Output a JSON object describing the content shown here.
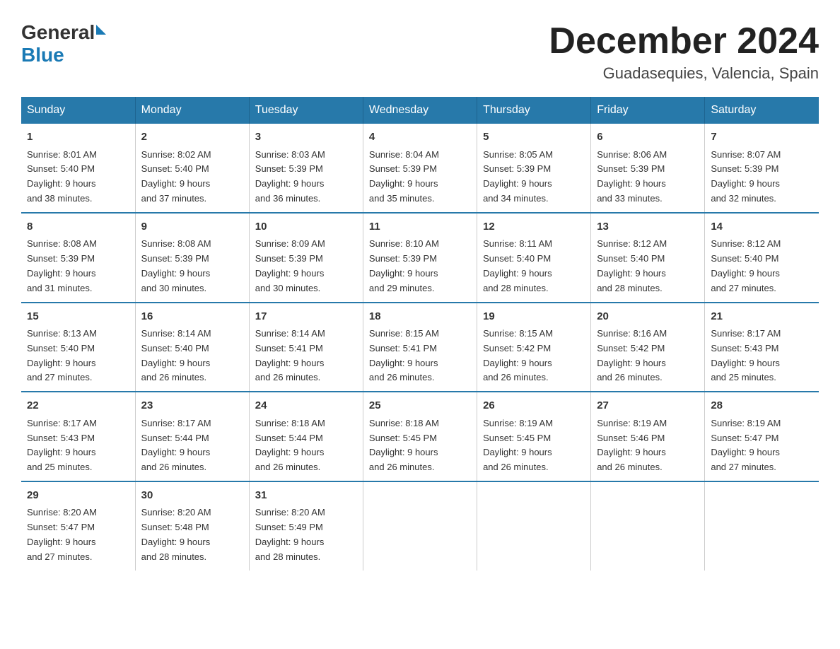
{
  "logo": {
    "general": "General",
    "triangle": "▶",
    "blue": "Blue"
  },
  "header": {
    "month": "December 2024",
    "location": "Guadasequies, Valencia, Spain"
  },
  "weekdays": [
    "Sunday",
    "Monday",
    "Tuesday",
    "Wednesday",
    "Thursday",
    "Friday",
    "Saturday"
  ],
  "weeks": [
    [
      {
        "day": "1",
        "sunrise": "8:01 AM",
        "sunset": "5:40 PM",
        "daylight": "9 hours and 38 minutes."
      },
      {
        "day": "2",
        "sunrise": "8:02 AM",
        "sunset": "5:40 PM",
        "daylight": "9 hours and 37 minutes."
      },
      {
        "day": "3",
        "sunrise": "8:03 AM",
        "sunset": "5:39 PM",
        "daylight": "9 hours and 36 minutes."
      },
      {
        "day": "4",
        "sunrise": "8:04 AM",
        "sunset": "5:39 PM",
        "daylight": "9 hours and 35 minutes."
      },
      {
        "day": "5",
        "sunrise": "8:05 AM",
        "sunset": "5:39 PM",
        "daylight": "9 hours and 34 minutes."
      },
      {
        "day": "6",
        "sunrise": "8:06 AM",
        "sunset": "5:39 PM",
        "daylight": "9 hours and 33 minutes."
      },
      {
        "day": "7",
        "sunrise": "8:07 AM",
        "sunset": "5:39 PM",
        "daylight": "9 hours and 32 minutes."
      }
    ],
    [
      {
        "day": "8",
        "sunrise": "8:08 AM",
        "sunset": "5:39 PM",
        "daylight": "9 hours and 31 minutes."
      },
      {
        "day": "9",
        "sunrise": "8:08 AM",
        "sunset": "5:39 PM",
        "daylight": "9 hours and 30 minutes."
      },
      {
        "day": "10",
        "sunrise": "8:09 AM",
        "sunset": "5:39 PM",
        "daylight": "9 hours and 30 minutes."
      },
      {
        "day": "11",
        "sunrise": "8:10 AM",
        "sunset": "5:39 PM",
        "daylight": "9 hours and 29 minutes."
      },
      {
        "day": "12",
        "sunrise": "8:11 AM",
        "sunset": "5:40 PM",
        "daylight": "9 hours and 28 minutes."
      },
      {
        "day": "13",
        "sunrise": "8:12 AM",
        "sunset": "5:40 PM",
        "daylight": "9 hours and 28 minutes."
      },
      {
        "day": "14",
        "sunrise": "8:12 AM",
        "sunset": "5:40 PM",
        "daylight": "9 hours and 27 minutes."
      }
    ],
    [
      {
        "day": "15",
        "sunrise": "8:13 AM",
        "sunset": "5:40 PM",
        "daylight": "9 hours and 27 minutes."
      },
      {
        "day": "16",
        "sunrise": "8:14 AM",
        "sunset": "5:40 PM",
        "daylight": "9 hours and 26 minutes."
      },
      {
        "day": "17",
        "sunrise": "8:14 AM",
        "sunset": "5:41 PM",
        "daylight": "9 hours and 26 minutes."
      },
      {
        "day": "18",
        "sunrise": "8:15 AM",
        "sunset": "5:41 PM",
        "daylight": "9 hours and 26 minutes."
      },
      {
        "day": "19",
        "sunrise": "8:15 AM",
        "sunset": "5:42 PM",
        "daylight": "9 hours and 26 minutes."
      },
      {
        "day": "20",
        "sunrise": "8:16 AM",
        "sunset": "5:42 PM",
        "daylight": "9 hours and 26 minutes."
      },
      {
        "day": "21",
        "sunrise": "8:17 AM",
        "sunset": "5:43 PM",
        "daylight": "9 hours and 25 minutes."
      }
    ],
    [
      {
        "day": "22",
        "sunrise": "8:17 AM",
        "sunset": "5:43 PM",
        "daylight": "9 hours and 25 minutes."
      },
      {
        "day": "23",
        "sunrise": "8:17 AM",
        "sunset": "5:44 PM",
        "daylight": "9 hours and 26 minutes."
      },
      {
        "day": "24",
        "sunrise": "8:18 AM",
        "sunset": "5:44 PM",
        "daylight": "9 hours and 26 minutes."
      },
      {
        "day": "25",
        "sunrise": "8:18 AM",
        "sunset": "5:45 PM",
        "daylight": "9 hours and 26 minutes."
      },
      {
        "day": "26",
        "sunrise": "8:19 AM",
        "sunset": "5:45 PM",
        "daylight": "9 hours and 26 minutes."
      },
      {
        "day": "27",
        "sunrise": "8:19 AM",
        "sunset": "5:46 PM",
        "daylight": "9 hours and 26 minutes."
      },
      {
        "day": "28",
        "sunrise": "8:19 AM",
        "sunset": "5:47 PM",
        "daylight": "9 hours and 27 minutes."
      }
    ],
    [
      {
        "day": "29",
        "sunrise": "8:20 AM",
        "sunset": "5:47 PM",
        "daylight": "9 hours and 27 minutes."
      },
      {
        "day": "30",
        "sunrise": "8:20 AM",
        "sunset": "5:48 PM",
        "daylight": "9 hours and 28 minutes."
      },
      {
        "day": "31",
        "sunrise": "8:20 AM",
        "sunset": "5:49 PM",
        "daylight": "9 hours and 28 minutes."
      },
      null,
      null,
      null,
      null
    ]
  ],
  "labels": {
    "sunrise": "Sunrise:",
    "sunset": "Sunset:",
    "daylight": "Daylight:"
  }
}
